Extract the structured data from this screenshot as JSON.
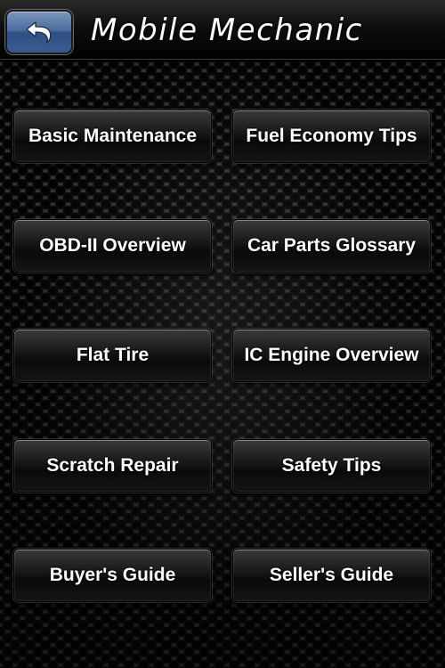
{
  "header": {
    "title": "Mobile Mechanic",
    "back_icon": "back-arrow-icon",
    "back_color": "#4d6ea0"
  },
  "menu": [
    {
      "label": "Basic Maintenance"
    },
    {
      "label": "Fuel Economy Tips"
    },
    {
      "label": "OBD-II Overview"
    },
    {
      "label": "Car Parts Glossary"
    },
    {
      "label": "Flat Tire"
    },
    {
      "label": "IC Engine Overview"
    },
    {
      "label": "Scratch Repair"
    },
    {
      "label": "Safety Tips"
    },
    {
      "label": "Buyer's Guide"
    },
    {
      "label": "Seller's Guide"
    }
  ]
}
